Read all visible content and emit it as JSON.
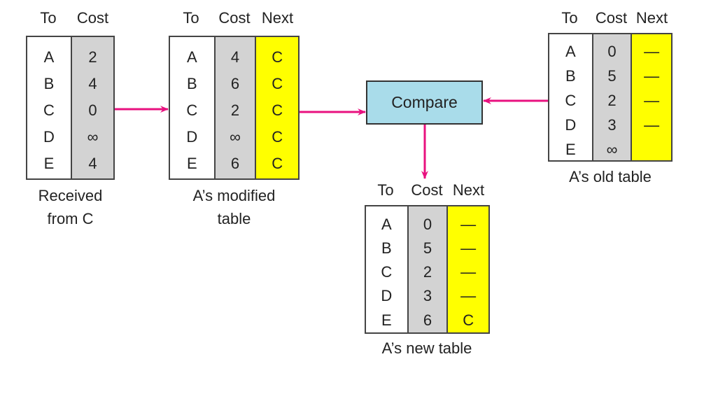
{
  "colors": {
    "arrow": "#e8117f",
    "cost_column": "#d3d3d3",
    "next_column": "#ffff00",
    "compare_box": "#a9dcea"
  },
  "compare_label": "Compare",
  "tables": [
    {
      "id": "received",
      "caption": [
        "Received",
        "from C"
      ],
      "headers": [
        "To",
        "Cost"
      ],
      "rows": [
        [
          "A",
          "2"
        ],
        [
          "B",
          "4"
        ],
        [
          "C",
          "0"
        ],
        [
          "D",
          "∞"
        ],
        [
          "E",
          "4"
        ]
      ]
    },
    {
      "id": "modified",
      "caption": [
        "A’s modified",
        "table"
      ],
      "headers": [
        "To",
        "Cost",
        "Next"
      ],
      "rows": [
        [
          "A",
          "4",
          "C"
        ],
        [
          "B",
          "6",
          "C"
        ],
        [
          "C",
          "2",
          "C"
        ],
        [
          "D",
          "∞",
          "C"
        ],
        [
          "E",
          "6",
          "C"
        ]
      ]
    },
    {
      "id": "old",
      "caption": [
        "A’s old table"
      ],
      "headers": [
        "To",
        "Cost",
        "Next"
      ],
      "rows": [
        [
          "A",
          "0",
          "—"
        ],
        [
          "B",
          "5",
          "—"
        ],
        [
          "C",
          "2",
          "—"
        ],
        [
          "D",
          "3",
          "—"
        ],
        [
          "E",
          "∞",
          ""
        ]
      ]
    },
    {
      "id": "new",
      "caption": [
        "A’s new table"
      ],
      "headers": [
        "To",
        "Cost",
        "Next"
      ],
      "rows": [
        [
          "A",
          "0",
          "—"
        ],
        [
          "B",
          "5",
          "—"
        ],
        [
          "C",
          "2",
          "—"
        ],
        [
          "D",
          "3",
          "—"
        ],
        [
          "E",
          "6",
          "C"
        ]
      ]
    }
  ]
}
